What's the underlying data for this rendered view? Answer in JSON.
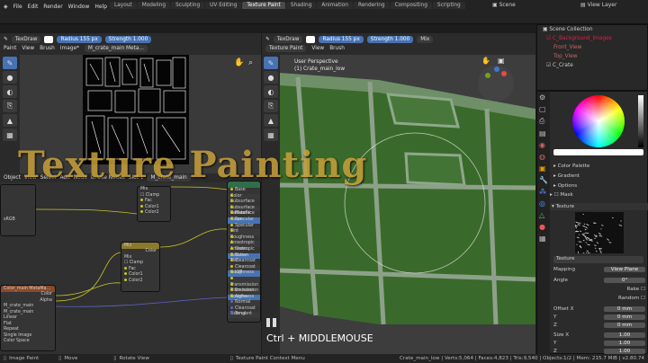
{
  "menu": [
    "File",
    "Edit",
    "Render",
    "Window",
    "Help"
  ],
  "workspaces": [
    "Layout",
    "Modeling",
    "Sculpting",
    "UV Editing",
    "Texture Paint",
    "Shading",
    "Animation",
    "Rendering",
    "Compositing",
    "Scripting"
  ],
  "scene": {
    "label": "Scene",
    "view_layer": "View Layer"
  },
  "left_header": {
    "brush": "TexDraw",
    "radius_label": "Radius",
    "radius_value": "155 px",
    "strength_label": "Strength",
    "strength_value": "1.000",
    "mode": "Paint",
    "menus": [
      "View",
      "Brush",
      "Image*"
    ],
    "image_name": "M_crate_main Meta..."
  },
  "viewport_header": {
    "brush": "TexDraw",
    "radius_label": "Radius",
    "radius_value": "155 px",
    "strength_label": "Strength",
    "strength_value": "1.000",
    "mix": "Mix",
    "mode": "Texture Paint",
    "menus": [
      "View",
      "Brush"
    ],
    "perspective": "User Perspective",
    "object": "(1) Crate_main_low"
  },
  "overlay_title": "Texture Painting",
  "shortcut_caption": "Ctrl + MIDDLEMOUSE",
  "node_header": {
    "object": "Object",
    "menus": [
      "View",
      "Select",
      "Add",
      "Node"
    ],
    "use_nodes": "Use Nodes",
    "slot": "Slot 1",
    "material": "M_crate_main"
  },
  "nodes": {
    "mix_node": {
      "title": "Mix",
      "rows": [
        "Mix",
        "Clamp",
        "Fac",
        "Color1",
        "Color2"
      ]
    },
    "mix_node2": {
      "title": "Mix",
      "rows": [
        "Color",
        "Mix",
        "Clamp",
        "Fac",
        "Color1",
        "Color2"
      ]
    },
    "image_node": {
      "title": "Color_main MetaMa...",
      "rows": [
        "Color",
        "Alpha",
        "M_crate_main",
        "M_crate_main",
        "Linear",
        "Flat",
        "Repeat",
        "Single Image",
        "Color Space"
      ]
    },
    "bsdf": {
      "rows": [
        "Base Color",
        "Subsurface",
        "Subsurface Radius",
        "Subsurface Color",
        "Metallic",
        "Specular",
        "Specular Tint",
        "Roughness",
        "Anisotropic",
        "Anisotropic Rotation",
        "Sheen",
        "Sheen Tint",
        "Clearcoat",
        "Clearcoat Roughness",
        "IOR",
        "Transmission",
        "Transmission Roughness",
        "Emission",
        "Alpha",
        "Normal",
        "Clearcoat Normal",
        "Tangent"
      ]
    },
    "srgb": "sRGB"
  },
  "outliner": {
    "title": "Scene Collection",
    "items": [
      "C_Background_Images",
      "Front_View",
      "Top_View",
      "C_Crate"
    ]
  },
  "properties": {
    "color_palette": "Color Palette",
    "gradient": "Gradient",
    "options": "Options",
    "mask": "Mask",
    "texture_section": "Texture",
    "texture_name": "Texture",
    "mapping_label": "Mapping",
    "mapping_value": "View Plane",
    "angle_label": "Angle",
    "angle_value": "0°",
    "rake": "Rake",
    "random": "Random",
    "offset_label": "Offset X",
    "offset_y": "Y",
    "offset_z": "Z",
    "offset_values": [
      "0 mm",
      "0 mm",
      "0 mm"
    ],
    "size_label": "Size X",
    "size_y": "Y",
    "size_z": "Z",
    "size_values": [
      "1.00",
      "1.00",
      "1.00"
    ]
  },
  "status": {
    "left": "Image Paint",
    "move": "Move",
    "rotate": "Rotate View",
    "context": "Texture Paint Context Menu",
    "stats": "Crate_main_low | Verts:5,064 | Faces:4,823 | Tris:9,540 | Objects:1/2 | Mem: 215.7 MiB | v2.80.74"
  },
  "colors": {
    "accent": "#4772b3",
    "title": "#c8a03a",
    "crate": "#3b6a2c"
  }
}
